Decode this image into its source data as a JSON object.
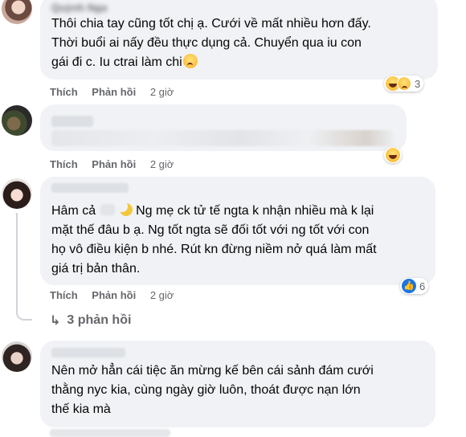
{
  "comments": [
    {
      "author": "Quỳnh Nga",
      "text": "Thôi chia tay cũng tốt chị ạ. Cưới về mất nhiều hơn đấy.\nThời buổi ai nấy đều thực dụng cả. Chuyển qua iu con\ngái đi c. Iu ctrai làm chi",
      "inline_emoji": "sad-face-emoji",
      "like_label": "Thích",
      "reply_label": "Phản hồi",
      "time": "2 giờ",
      "reactions": [
        "haha",
        "sad"
      ],
      "reaction_count": "3"
    },
    {
      "author": "",
      "text": "",
      "like_label": "Thích",
      "reply_label": "Phản hồi",
      "time": "2 giờ",
      "reactions": [
        "haha"
      ]
    },
    {
      "author": "",
      "text_prefix": "Hâm cả",
      "text": "Ng mẹ ck tử tế ngta k nhận nhiều mà k lại\nmặt thế đâu b ạ. Ng tốt ngta sẽ đối tốt với ng tốt với con\nhọ vô điều kiện b nhé. Rút kn đừng niềm nở quá làm mất\ngiá trị bản thân.",
      "like_label": "Thích",
      "reply_label": "Phản hồi",
      "time": "2 giờ",
      "reactions": [
        "like"
      ],
      "reaction_count": "6",
      "replies_label": "3 phản hồi"
    },
    {
      "author": "",
      "text": "Nên mở hẳn cái tiệc ăn mừng kế bên cái sảnh đám cưới\nthằng nyc kia, cùng ngày giờ luôn, thoát được nạn lớn\nthế kia mà"
    }
  ],
  "colors": {
    "bubble": "#f0f2f5",
    "meta": "#65676b",
    "like_blue": "#1b74e4"
  }
}
